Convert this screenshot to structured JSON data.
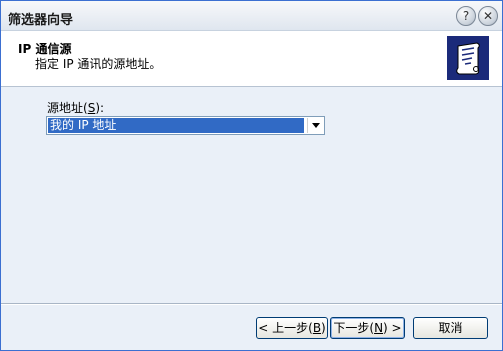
{
  "window": {
    "title": "筛选器向导"
  },
  "titlebar_buttons": {
    "help_glyph": "?",
    "close_glyph": "✕"
  },
  "header": {
    "title": "IP 通信源",
    "subtitle": "指定 IP 通讯的源地址。",
    "icon": "scroll-document-icon"
  },
  "form": {
    "label_prefix": "源地址(",
    "label_access_key": "S",
    "label_suffix": "):",
    "selected_value": "我的 IP 地址"
  },
  "buttons": {
    "back_prefix": "< 上一步(",
    "back_key": "B",
    "back_suffix": ")",
    "next_prefix": "下一步(",
    "next_key": "N",
    "next_suffix": ") >",
    "cancel": "取消"
  },
  "colors": {
    "selection": "#316ac5",
    "header_icon_bg": "#1b2a7a",
    "window_bg": "#eaf0f8"
  }
}
